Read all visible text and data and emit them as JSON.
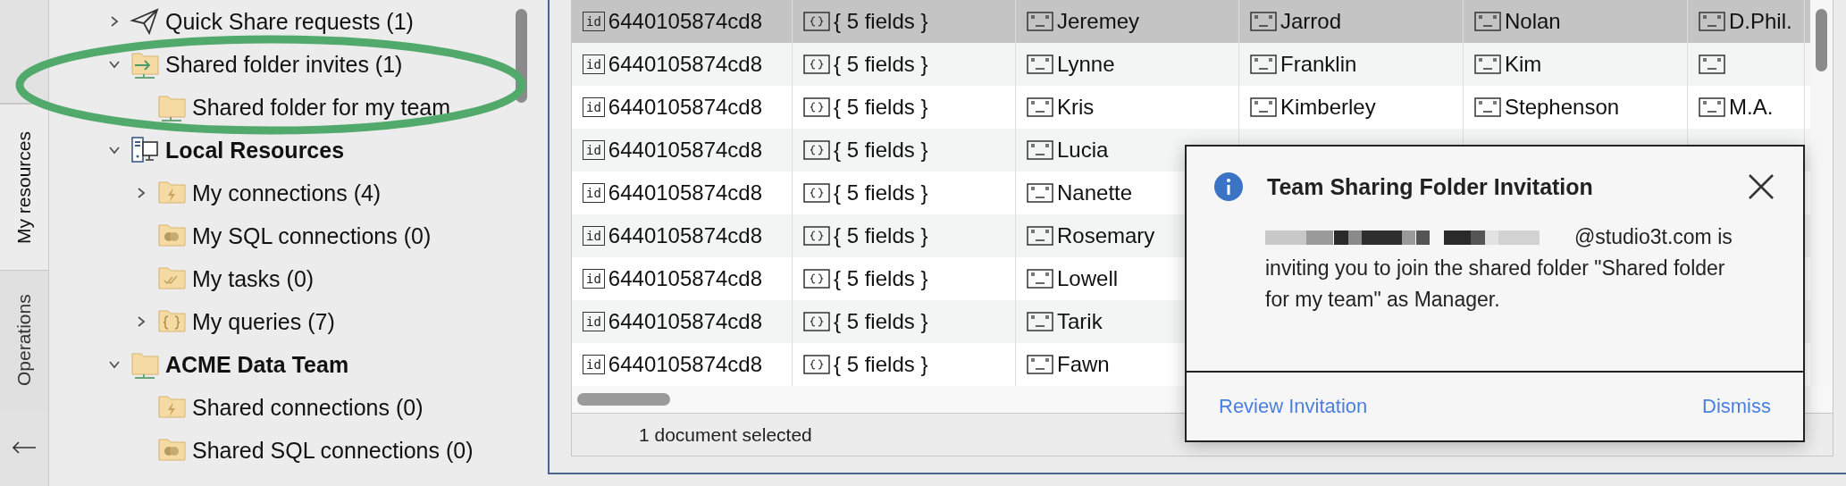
{
  "side_tabs": [
    {
      "label": "My resources",
      "selected": true
    },
    {
      "label": "Operations",
      "selected": false
    }
  ],
  "tree": [
    {
      "kind": "share-requests",
      "label": "Quick Share requests (1)",
      "expanded": false
    },
    {
      "kind": "invites",
      "label": "Shared folder invites (1)",
      "expanded": true,
      "children": [
        {
          "kind": "shared-folder",
          "label": "Shared folder for my team"
        }
      ]
    },
    {
      "kind": "local",
      "label": "Local Resources",
      "expanded": true,
      "children": [
        {
          "kind": "connections",
          "label": "My connections (4)",
          "expanded": false
        },
        {
          "kind": "sql",
          "label": "My SQL connections (0)"
        },
        {
          "kind": "tasks",
          "label": "My tasks (0)"
        },
        {
          "kind": "queries",
          "label": "My queries (7)",
          "expanded": false
        }
      ]
    },
    {
      "kind": "team",
      "label": "ACME Data Team",
      "expanded": true,
      "children": [
        {
          "kind": "connections",
          "label": "Shared connections (0)"
        },
        {
          "kind": "sql",
          "label": "Shared SQL connections (0)"
        }
      ]
    }
  ],
  "table": {
    "rows": [
      {
        "selected": true,
        "cells": [
          {
            "kind": "id",
            "badge": "id",
            "text": "6440105874cd8"
          },
          {
            "kind": "object",
            "text": "{ 5 fields }"
          },
          {
            "kind": "string",
            "text": "Jeremey"
          },
          {
            "kind": "string",
            "text": "Jarrod"
          },
          {
            "kind": "string",
            "text": "Nolan"
          },
          {
            "kind": "string",
            "text": "D.Phil."
          }
        ]
      },
      {
        "selected": false,
        "cells": [
          {
            "kind": "id",
            "badge": "id",
            "text": "6440105874cd8"
          },
          {
            "kind": "object",
            "text": "{ 5 fields }"
          },
          {
            "kind": "string",
            "text": "Lynne"
          },
          {
            "kind": "string",
            "text": "Franklin"
          },
          {
            "kind": "string",
            "text": "Kim"
          },
          {
            "kind": "string"
          }
        ]
      },
      {
        "selected": false,
        "cells": [
          {
            "kind": "id",
            "badge": "id",
            "text": "6440105874cd8"
          },
          {
            "kind": "object",
            "text": "{ 5 fields }"
          },
          {
            "kind": "string",
            "text": "Kris"
          },
          {
            "kind": "string",
            "text": "Kimberley"
          },
          {
            "kind": "string",
            "text": "Stephenson"
          },
          {
            "kind": "string",
            "text": "M.A."
          }
        ]
      },
      {
        "selected": false,
        "cells": [
          {
            "kind": "id",
            "badge": "id",
            "text": "6440105874cd8"
          },
          {
            "kind": "object",
            "text": "{ 5 fields }"
          },
          {
            "kind": "string",
            "text": "Lucia"
          }
        ]
      },
      {
        "selected": false,
        "cells": [
          {
            "kind": "id",
            "badge": "id",
            "text": "6440105874cd8"
          },
          {
            "kind": "object",
            "text": "{ 5 fields }"
          },
          {
            "kind": "string",
            "text": "Nanette"
          }
        ]
      },
      {
        "selected": false,
        "cells": [
          {
            "kind": "id",
            "badge": "id",
            "text": "6440105874cd8"
          },
          {
            "kind": "object",
            "text": "{ 5 fields }"
          },
          {
            "kind": "string",
            "text": "Rosemary"
          }
        ]
      },
      {
        "selected": false,
        "cells": [
          {
            "kind": "id",
            "badge": "id",
            "text": "6440105874cd8"
          },
          {
            "kind": "object",
            "text": "{ 5 fields }"
          },
          {
            "kind": "string",
            "text": "Lowell"
          }
        ]
      },
      {
        "selected": false,
        "cells": [
          {
            "kind": "id",
            "badge": "id",
            "text": "6440105874cd8"
          },
          {
            "kind": "object",
            "text": "{ 5 fields }"
          },
          {
            "kind": "string",
            "text": "Tarik"
          }
        ]
      },
      {
        "selected": false,
        "cells": [
          {
            "kind": "id",
            "badge": "id",
            "text": "6440105874cd8"
          },
          {
            "kind": "object",
            "text": "{ 5 fields }"
          },
          {
            "kind": "string",
            "text": "Fawn"
          }
        ]
      }
    ]
  },
  "status_bar": {
    "text": "1 document selected"
  },
  "notification": {
    "title": "Team Sharing Folder Invitation",
    "sender_suffix": "@studio3t.com is",
    "message": "inviting you to join the shared folder \"Shared folder for my team\" as Manager.",
    "actions": [
      {
        "label": "Review Invitation"
      },
      {
        "label": "Dismiss"
      }
    ]
  }
}
